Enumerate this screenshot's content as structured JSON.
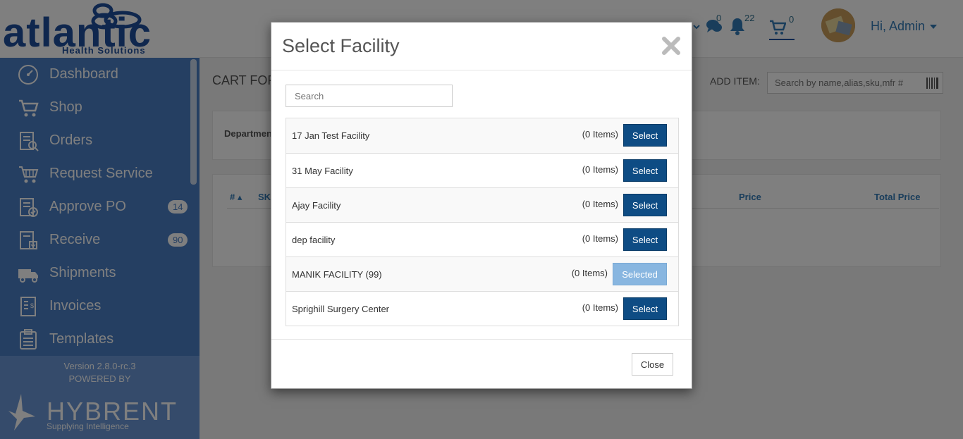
{
  "brand": {
    "logo_word": "atlantic",
    "logo_sub": "Health Solutions",
    "colors": {
      "primary": "#1e4e9c",
      "sidebar": "#4a7ec4",
      "button": "#0e4c84",
      "button_selected": "#88b6e0"
    }
  },
  "sidebar": {
    "items": [
      {
        "label": "Dashboard",
        "icon": "dashboard-icon"
      },
      {
        "label": "Shop",
        "icon": "cart-icon"
      },
      {
        "label": "Orders",
        "icon": "orders-icon"
      },
      {
        "label": "Request Service",
        "icon": "request-service-icon"
      },
      {
        "label": "Approve PO",
        "icon": "approve-po-icon",
        "badge": "14"
      },
      {
        "label": "Receive",
        "icon": "receive-icon",
        "badge": "90"
      },
      {
        "label": "Shipments",
        "icon": "truck-icon"
      },
      {
        "label": "Invoices",
        "icon": "invoice-icon"
      },
      {
        "label": "Templates",
        "icon": "templates-icon"
      }
    ],
    "version": "Version 2.8.0-rc.3",
    "powered_by": "POWERED BY",
    "powered_brand": "HYBRENT",
    "powered_tagline": "Supplying Intelligence"
  },
  "topbar": {
    "messages_count": "0",
    "notifications_count": "22",
    "cart_count": "0",
    "greeting": "Hi, Admin"
  },
  "main": {
    "title": "CART FOR",
    "add_item_label": "ADD ITEM:",
    "add_item_placeholder": "Search by name,alias,sku,mfr #",
    "department_label": "Departmen",
    "table_headers": {
      "num": "#",
      "sku": "SKU",
      "price": "Price",
      "total": "Total Price"
    }
  },
  "modal": {
    "title": "Select Facility",
    "search_placeholder": "Search",
    "facilities": [
      {
        "name": "17 Jan Test Facility",
        "items": "(0 Items)",
        "action": "Select"
      },
      {
        "name": "31 May Facility",
        "items": "(0 Items)",
        "action": "Select"
      },
      {
        "name": "Ajay Facility",
        "items": "(0 Items)",
        "action": "Select"
      },
      {
        "name": "dep facility",
        "items": "(0 Items)",
        "action": "Select"
      },
      {
        "name": "MANIK FACILITY (99)",
        "items": "(0 Items)",
        "action": "Selected",
        "selected": true
      },
      {
        "name": "Sprighill Surgery Center",
        "items": "(0 Items)",
        "action": "Select"
      }
    ],
    "close_label": "Close"
  }
}
